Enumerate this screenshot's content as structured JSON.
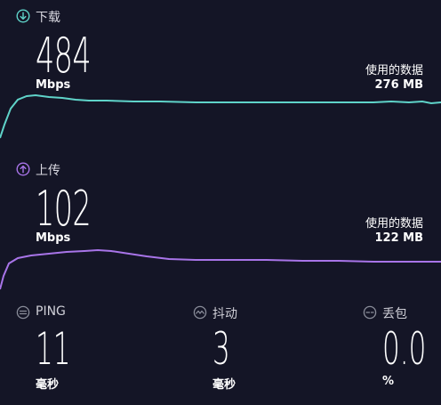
{
  "download": {
    "label": "下载",
    "value": "484",
    "unit": "Mbps",
    "data_used_label": "使用的数据",
    "data_used_value": "276 MB",
    "color": "#5fd3c9"
  },
  "upload": {
    "label": "上传",
    "value": "102",
    "unit": "Mbps",
    "data_used_label": "使用的数据",
    "data_used_value": "122 MB",
    "color": "#a874e8"
  },
  "metrics": [
    {
      "icon": "ping-icon",
      "label": "PING",
      "value": "11",
      "unit": "毫秒"
    },
    {
      "icon": "jitter-icon",
      "label": "抖动",
      "value": "3",
      "unit": "毫秒"
    },
    {
      "icon": "packet-loss-icon",
      "label": "丢包",
      "value": "0.0",
      "unit": "%"
    }
  ]
}
